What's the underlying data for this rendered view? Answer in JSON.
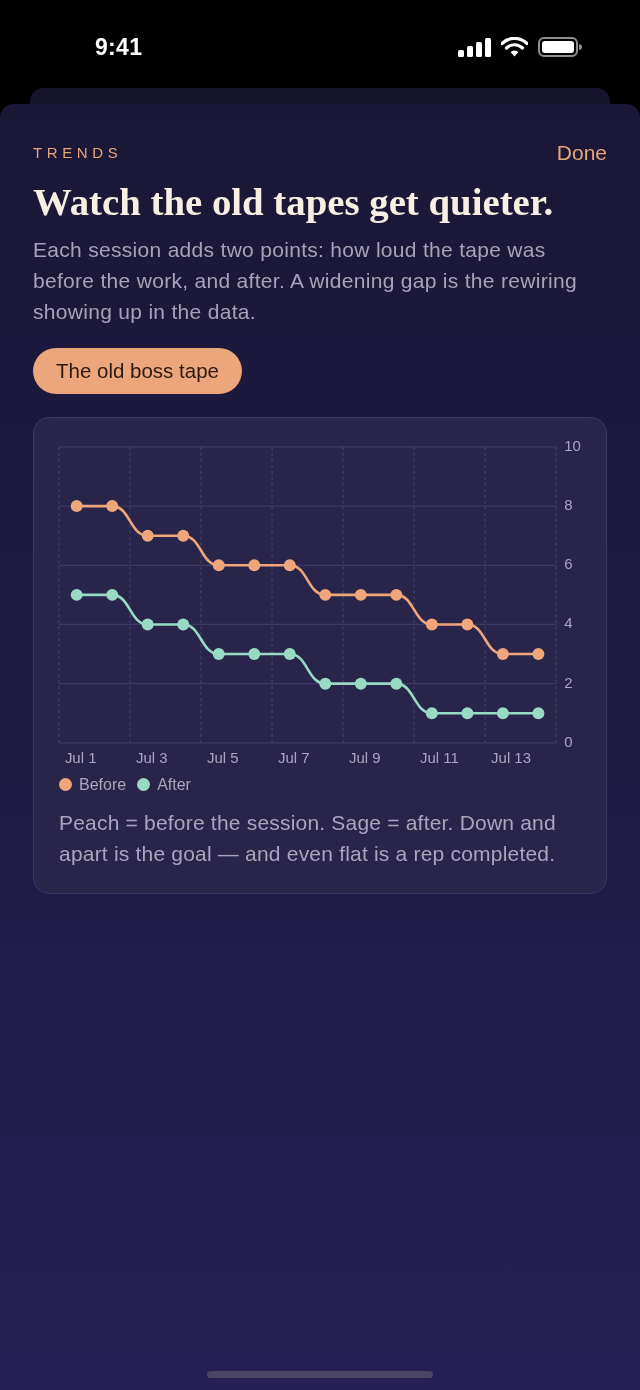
{
  "status_bar": {
    "time": "9:41"
  },
  "header": {
    "eyebrow": "TRENDS",
    "done": "Done"
  },
  "title": "Watch the old tapes get quieter.",
  "description": "Each session adds two points: how loud the tape was before the work, and after. A widening gap is the rewiring showing up in the data.",
  "tape_selector": {
    "label": "The old boss tape"
  },
  "chart": {
    "chart_data": {
      "type": "line",
      "grid": true,
      "categories": [
        "Jul 1",
        null,
        "Jul 3",
        null,
        "Jul 5",
        null,
        "Jul 7",
        null,
        "Jul 9",
        null,
        "Jul 11",
        null,
        "Jul 13",
        null
      ],
      "ylim": [
        0,
        10
      ],
      "yticks": [
        0,
        2,
        4,
        6,
        8,
        10
      ],
      "series": [
        {
          "name": "Before",
          "color": "#eea67a",
          "marker": "circle",
          "values": [
            8,
            8,
            7,
            7,
            6,
            6,
            6,
            5,
            5,
            5,
            4,
            4,
            3,
            3
          ]
        },
        {
          "name": "After",
          "color": "#98dac3",
          "marker": "circle",
          "values": [
            5,
            5,
            4,
            4,
            3,
            3,
            3,
            2,
            2,
            2,
            1,
            1,
            1,
            1
          ]
        }
      ]
    },
    "caption": "Peach = before the session. Sage = after. Down and apart is the goal — and even flat is a rep completed."
  }
}
